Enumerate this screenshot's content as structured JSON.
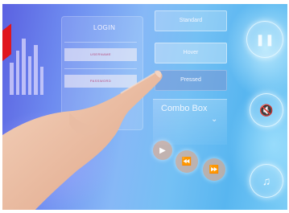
{
  "login_panel": {
    "title": "LOGIN",
    "username_label": "USERNAME",
    "password_label": "PASSWORD"
  },
  "buttons": {
    "standard": "Standard",
    "hover": "Hover",
    "pressed": "Pressed"
  },
  "combo_box": {
    "label": "Combo Box",
    "chevron": "⌄"
  },
  "media_controls": {
    "play_icon": "▶",
    "rewind_icon": "⏪",
    "forward_icon": "⏩"
  },
  "side_icons": {
    "pause_icon": "❚❚",
    "mute_icon": "🔇",
    "music_icon": "♫"
  },
  "colors": {
    "accent_red": "#e0161d",
    "background_violet": "#5a5fe0",
    "background_cyan": "#58b6f0",
    "media_button": "#ffaa78"
  }
}
